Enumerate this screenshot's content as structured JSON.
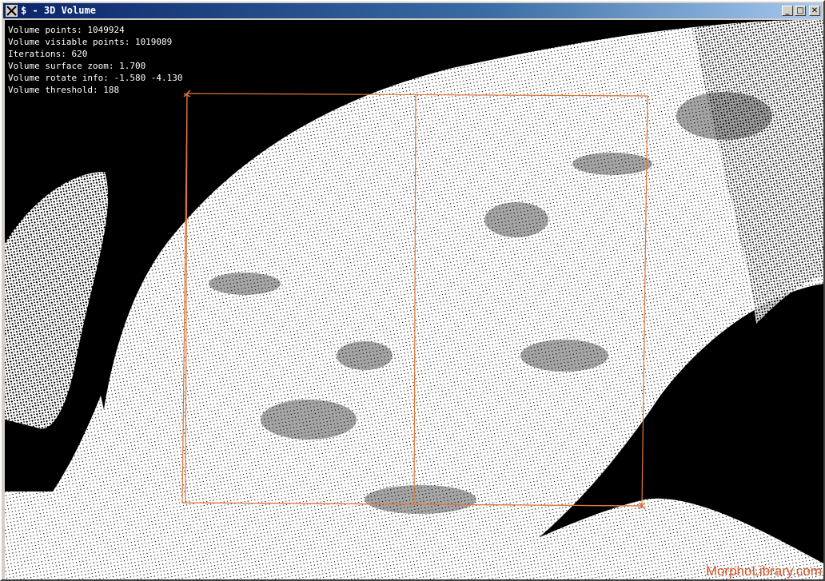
{
  "window": {
    "title": "$ - 3D Volume",
    "buttons": {
      "minimize": "_",
      "maximize": "□",
      "close": "✕"
    }
  },
  "info": {
    "volume_points": "Volume points: 1049924",
    "visible_points": "Volume visiable points: 1019089",
    "iterations": "Iterations: 620",
    "surface_zoom": "Volume surface zoom: 1.700",
    "rotate_info": "Volume rotate info: -1.580 -4.130",
    "threshold": "Volume threshold: 188"
  },
  "watermark": "MorphoLibrary.com",
  "colors": {
    "background": "#000000",
    "volume": "#ffffff",
    "bounding_box": "#e0783c",
    "watermark": "#d4582a"
  }
}
